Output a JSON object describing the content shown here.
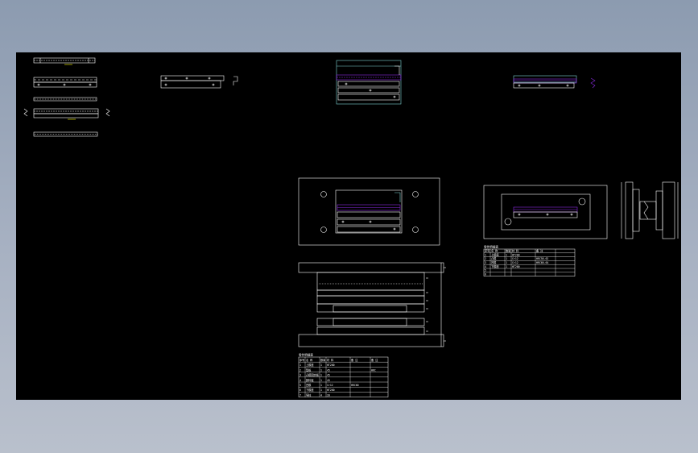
{
  "colors": {
    "background_outer": "#8c9bb0",
    "canvas": "#000000",
    "line_white": "#ffffff",
    "line_cyan": "#7fd4d4",
    "line_purple": "#8a2be2",
    "line_yellow": "#ffff00"
  },
  "drawing": {
    "views": [
      "strip-layout-1",
      "strip-layout-2",
      "strip-layout-3",
      "strip-layout-4",
      "strip-layout-5",
      "part-view-strip",
      "top-center-assembly",
      "top-right-strip",
      "die-plan-view",
      "die-elevation-view",
      "right-plan-view",
      "right-section-view"
    ]
  },
  "bom_tables": {
    "right": {
      "title": "零件明细表",
      "headers": [
        "序号",
        "名 称",
        "数量",
        "材 料",
        "备 注"
      ],
      "rows": [
        [
          "1",
          "上模座",
          "1",
          "HT200",
          ""
        ],
        [
          "2",
          "凸模",
          "1",
          "Cr12",
          "HRC58-62"
        ],
        [
          "3",
          "凹模",
          "1",
          "Cr12",
          "HRC60-64"
        ],
        [
          "4",
          "下模座",
          "1",
          "HT200",
          ""
        ],
        [
          "5",
          "",
          "",
          "",
          " "
        ],
        [
          "6",
          "",
          "",
          "",
          ""
        ]
      ]
    },
    "bottom": {
      "title": "零件明细表",
      "headers": [
        "序号",
        "名 称",
        "数量",
        "材 料",
        "备 注",
        "备 注"
      ],
      "rows": [
        [
          "1",
          "上模座",
          "1",
          "HT200",
          "",
          ""
        ],
        [
          "2",
          "垫板",
          "1",
          "45",
          "",
          "HRC"
        ],
        [
          "3",
          "凸模固定板",
          "1",
          "45",
          "",
          ""
        ],
        [
          "4",
          "卸料板",
          "1",
          "45",
          "",
          ""
        ],
        [
          "5",
          "凹模",
          "1",
          "Cr12",
          "HRC60",
          ""
        ],
        [
          "6",
          "下模座",
          "1",
          "HT200",
          "",
          ""
        ],
        [
          "7",
          "导柱",
          "4",
          "20",
          "",
          ""
        ]
      ]
    }
  }
}
